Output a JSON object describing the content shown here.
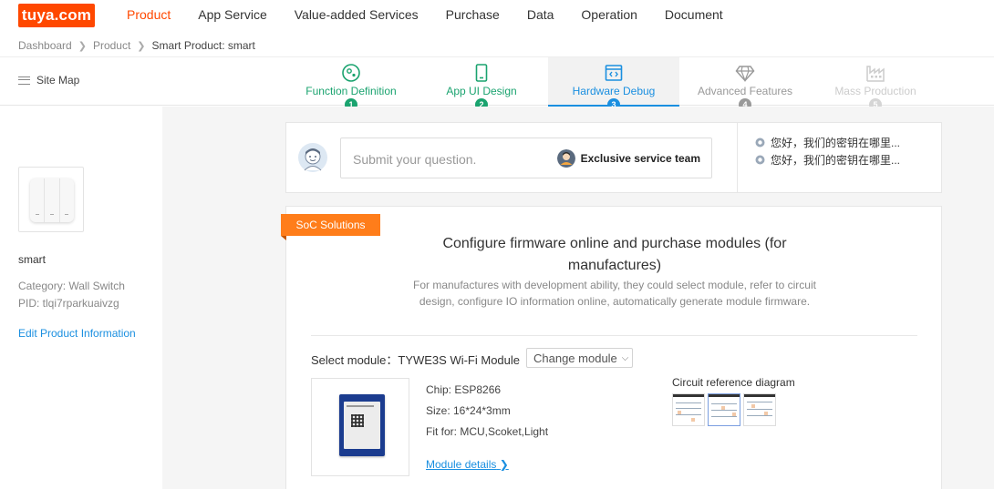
{
  "brand": {
    "logo_text": "tuya.com",
    "color": "#ff4800"
  },
  "nav": {
    "items": [
      {
        "label": "Product",
        "active": true
      },
      {
        "label": "App Service"
      },
      {
        "label": "Value-added Services"
      },
      {
        "label": "Purchase"
      },
      {
        "label": "Data"
      },
      {
        "label": "Operation"
      },
      {
        "label": "Document"
      }
    ]
  },
  "breadcrumb": {
    "items": [
      "Dashboard",
      "Product",
      "Smart Product: smart"
    ]
  },
  "sitemap": {
    "label": "Site Map"
  },
  "steps": [
    {
      "label": "Function Definition",
      "num": "1",
      "state": "done",
      "icon": "function-icon"
    },
    {
      "label": "App UI Design",
      "num": "2",
      "state": "done",
      "icon": "phone-icon"
    },
    {
      "label": "Hardware Debug",
      "num": "3",
      "state": "current",
      "icon": "code-icon"
    },
    {
      "label": "Advanced Features",
      "num": "4",
      "state": "next",
      "icon": "diamond-icon"
    },
    {
      "label": "Mass Production",
      "num": "5",
      "state": "disabled",
      "icon": "factory-icon"
    }
  ],
  "product": {
    "name": "smart",
    "category": "Category: Wall Switch",
    "pid": "PID: tlqi7rparkuaivzg",
    "edit_label": "Edit Product Information"
  },
  "question": {
    "placeholder": "Submit your question.",
    "service_label": "Exclusive service team",
    "faqs": [
      "您好，我们的密钥在哪里...",
      "您好，我们的密钥在哪里..."
    ]
  },
  "soc": {
    "tag": "SoC Solutions",
    "title": "Configure firmware online and purchase modules (for manufactures)",
    "description": "For manufactures with development ability, they could select module, refer to circuit design, configure IO information online, automatically generate module firmware.",
    "select_label": "Select module：TYWE3S Wi-Fi Module",
    "change_label": "Change module",
    "chip": "Chip: ESP8266",
    "size": "Size: 16*24*3mm",
    "fit": "Fit for: MCU,Scoket,Light",
    "details_label": "Module details",
    "circuit_title": "Circuit reference diagram"
  },
  "colors": {
    "accent": "#1a8fe0",
    "done": "#1aa36f",
    "tag": "#ff7d1a"
  }
}
